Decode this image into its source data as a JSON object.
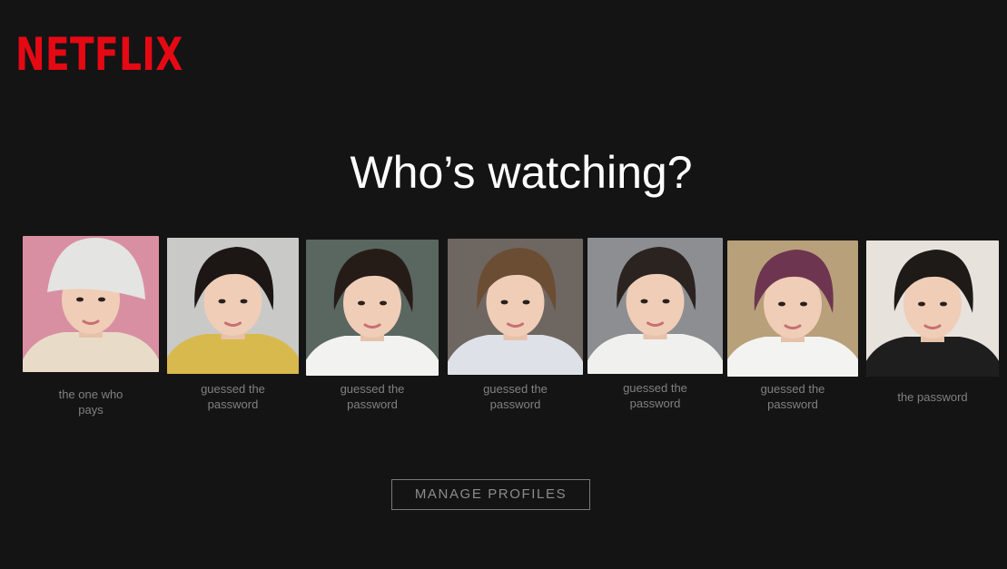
{
  "brand": {
    "logo_text": "NETFLIX",
    "logo_color": "#e50914"
  },
  "heading": "Who’s watching?",
  "profiles": [
    {
      "name": "the one who\npays",
      "avatar": "profile-photo",
      "background": "#d98fa2",
      "hair": "#e4e4e2",
      "shirt": "#e8dcc8",
      "hat": true
    },
    {
      "name": "guessed the\npassword",
      "avatar": "profile-photo",
      "background": "#c9c9c7",
      "hair": "#1c1614",
      "shirt": "#d8b94e"
    },
    {
      "name": "guessed the\npassword",
      "avatar": "profile-photo",
      "background": "#5a6660",
      "hair": "#261c17",
      "shirt": "#f2f2f0"
    },
    {
      "name": "guessed the\npassword",
      "avatar": "profile-photo",
      "background": "#6e6661",
      "hair": "#6b4d33",
      "shirt": "#dfe1e8"
    },
    {
      "name": "guessed the\npassword",
      "avatar": "profile-photo",
      "background": "#8d8e91",
      "hair": "#2b2320",
      "shirt": "#f0f0ee"
    },
    {
      "name": "guessed the\npassword",
      "avatar": "profile-photo",
      "background": "#b8a07a",
      "hair": "#6e3550",
      "shirt": "#f3f3f1"
    },
    {
      "name": "the password",
      "avatar": "profile-photo",
      "background": "#e8e2dc",
      "hair": "#1d1a18",
      "shirt": "#1e1e1e"
    }
  ],
  "manage_button": "MANAGE PROFILES"
}
